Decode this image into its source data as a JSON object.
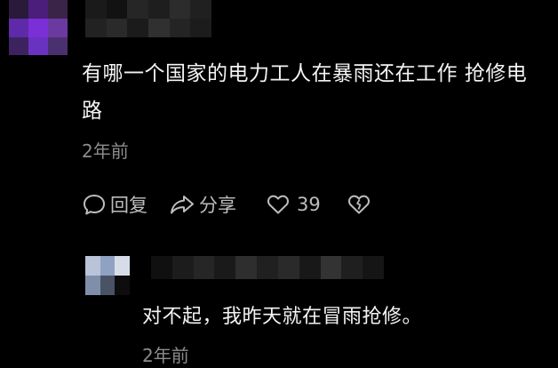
{
  "comment": {
    "text": "有哪一个国家的电力工人在暴雨还在工作 抢修电路",
    "time": "2年前",
    "actions": {
      "reply_label": "回复",
      "share_label": "分享",
      "like_count": "39"
    }
  },
  "reply": {
    "text": "对不起，我昨天就在冒雨抢修。",
    "time": "2年前"
  },
  "colors": {
    "background": "#000000",
    "text": "#f4f4f4",
    "secondary_text": "#8c8c8c",
    "icon": "#bdbdbd",
    "avatar_accent": "#7b2fd6"
  }
}
